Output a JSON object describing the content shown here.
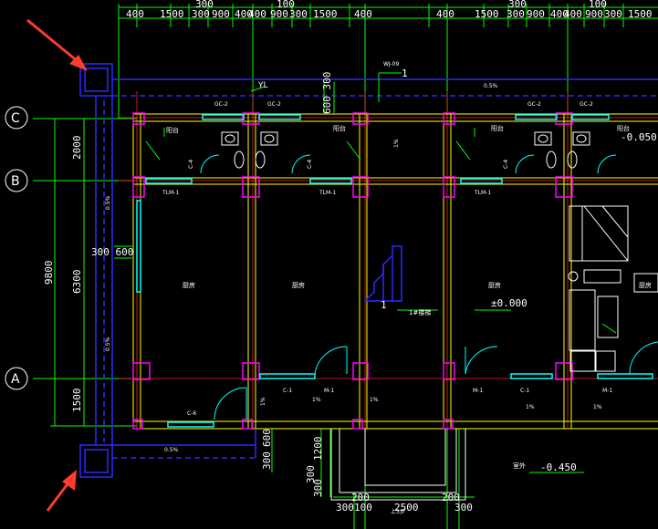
{
  "axes": {
    "c": "C",
    "b": "B",
    "a": "A"
  },
  "top_dims": [
    "400",
    "1500",
    "300",
    "900",
    "400",
    "400",
    "900",
    "300",
    "1500",
    "400",
    "400",
    "1500",
    "300",
    "900",
    "400",
    "400",
    "900",
    "300",
    "1500"
  ],
  "top_dims_upper": [
    "300",
    "100",
    "300",
    "100"
  ],
  "left_dims": {
    "total": "9800",
    "d2000": "2000",
    "d6300": "6300",
    "d1500": "1500"
  },
  "labels": {
    "opening": "300 600",
    "yl": "YL",
    "gc_a": "GC-2",
    "gc_b": "GC-2",
    "gc_c": "GC-2",
    "gc_d": "GC-2",
    "wj": "WJ-09",
    "wj_num": "1",
    "slope_top": "0.5%",
    "slope_bot": "0.5%",
    "slope_left_upper": "0.5%",
    "slope_left_lower": "0.5%",
    "dim_600_300": "600 300",
    "balcony_l": "阳台",
    "balcony_r": "阳台",
    "kitchen_l": "厨房",
    "kitchen_m": "厨房",
    "kitchen_r": "厨房",
    "kitchen_far": "厨房",
    "level_zero": "±0.000",
    "level_neg005": "-0.050",
    "level_neg045": "-0.450",
    "outdoor": "室外",
    "stair": "1#楼梯",
    "tlm_a": "TLM-1",
    "tlm_b": "TLM-1",
    "tlm_c": "TLM-1",
    "c6": "C-6",
    "c1a": "C-1",
    "m1a": "M-1",
    "m1b": "M-1",
    "c1b": "C-1",
    "m1c": "M-1",
    "c4a": "C-4",
    "c4b": "C-4",
    "c4c": "C-4",
    "pct1": "1%",
    "pct2": "1%",
    "pct3": "1%",
    "pct4": "1%",
    "pct5": "1%",
    "pct6": "1%",
    "steps": "上3步",
    "bottom_dims": [
      "300",
      "100",
      "200",
      "2500",
      "200",
      "300"
    ],
    "vert_dims": [
      "300",
      "600",
      "1200",
      "300",
      "300"
    ],
    "stair_num": "1"
  },
  "colors": {
    "axis": "#00ff00",
    "wall": "#ff2020",
    "drain": "#2a2aff",
    "window": "#00ffff",
    "column": "#ff00ff",
    "structure": "#ffff00",
    "arrow": "#ff3b2f"
  }
}
